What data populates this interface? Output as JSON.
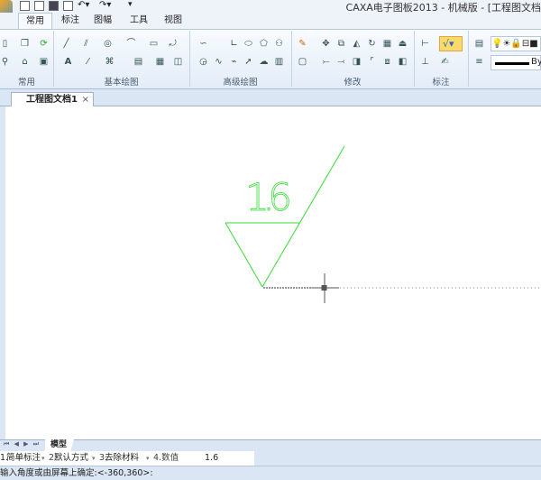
{
  "window": {
    "title": "CAXA电子图板2013 - 机械版 - [工程图文档"
  },
  "quick_access": [
    "new-icon",
    "open-icon",
    "save-icon",
    "print-icon",
    "undo-icon",
    "redo-icon"
  ],
  "ribbon_tabs": [
    {
      "label": "常用",
      "active": true
    },
    {
      "label": "标注"
    },
    {
      "label": "图幅"
    },
    {
      "label": "工具"
    },
    {
      "label": "视图"
    }
  ],
  "ribbon_groups": [
    {
      "label": "常用"
    },
    {
      "label": "基本绘图"
    },
    {
      "label": "高级绘图"
    },
    {
      "label": "修改"
    },
    {
      "label": "标注"
    }
  ],
  "layer_line_label": "By",
  "document_tab": {
    "label": "工程图文档1",
    "close": "×"
  },
  "drawing": {
    "roughness_value": "1.6",
    "symbol_color": "#33dd33"
  },
  "sheet_tabs": {
    "nav": [
      "⏮",
      "◀",
      "▶",
      "⏭"
    ],
    "model": "模型"
  },
  "property_bar": {
    "field1": {
      "prefix": "1.",
      "value": "简单标注"
    },
    "field2": {
      "prefix": "2.",
      "value": "默认方式"
    },
    "field3": {
      "prefix": "3.",
      "value": "去除材料"
    },
    "field4": {
      "label": "4.数值",
      "value": "1.6"
    }
  },
  "status": {
    "prompt": "输入角度或由屏幕上确定:<-360,360>:"
  }
}
